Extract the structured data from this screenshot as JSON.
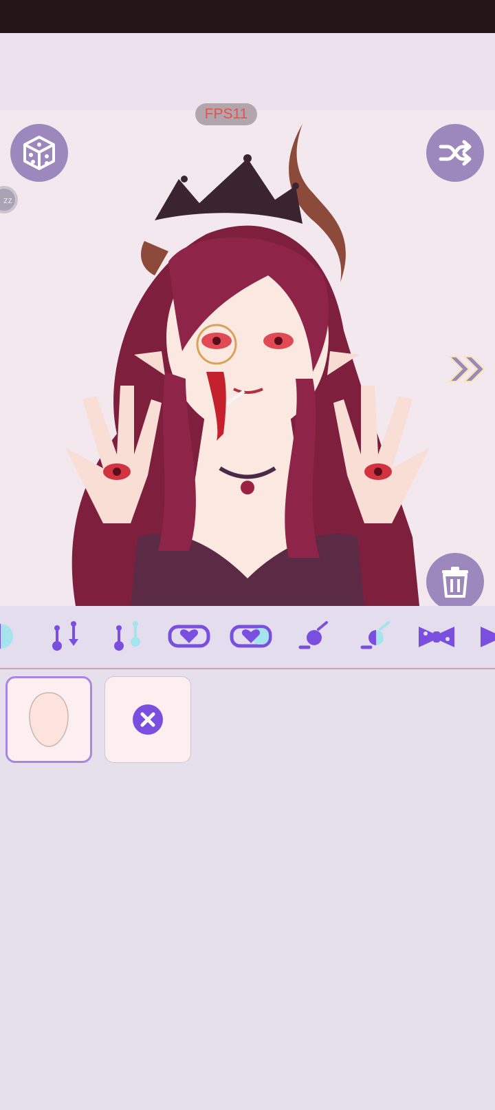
{
  "fps": {
    "label": "FPS11"
  },
  "left_indicator": {
    "text": "zz"
  },
  "buttons": {
    "random": {
      "icon": "dice-icon"
    },
    "shuffle": {
      "icon": "shuffle-icon"
    },
    "next": {
      "icon": "double-chevron-right-icon"
    },
    "delete": {
      "icon": "trash-icon"
    }
  },
  "categories": [
    {
      "name": "color-half-circle",
      "icon": "half-color-circle-icon"
    },
    {
      "name": "piercing-purple",
      "icon": "piercing-pair-icon"
    },
    {
      "name": "piercing-colored",
      "icon": "piercing-pair-color-icon"
    },
    {
      "name": "heart-mouth",
      "icon": "heart-mouth-icon"
    },
    {
      "name": "heart-mouth-colored",
      "icon": "heart-mouth-color-icon"
    },
    {
      "name": "nose-ring",
      "icon": "nose-ring-icon"
    },
    {
      "name": "nose-ring-colored",
      "icon": "nose-ring-color-icon"
    },
    {
      "name": "bow",
      "icon": "bow-icon"
    },
    {
      "name": "partial",
      "icon": "partial-icon"
    }
  ],
  "items": [
    {
      "name": "face-base",
      "icon": "face-shape-icon",
      "selected": true
    },
    {
      "name": "none",
      "icon": "remove-x-icon",
      "selected": false
    }
  ],
  "colors": {
    "accent": "#7a4fe0",
    "button_bg": "#9c88bc",
    "statusbar": "#241519",
    "fps_text": "#e2534f"
  }
}
